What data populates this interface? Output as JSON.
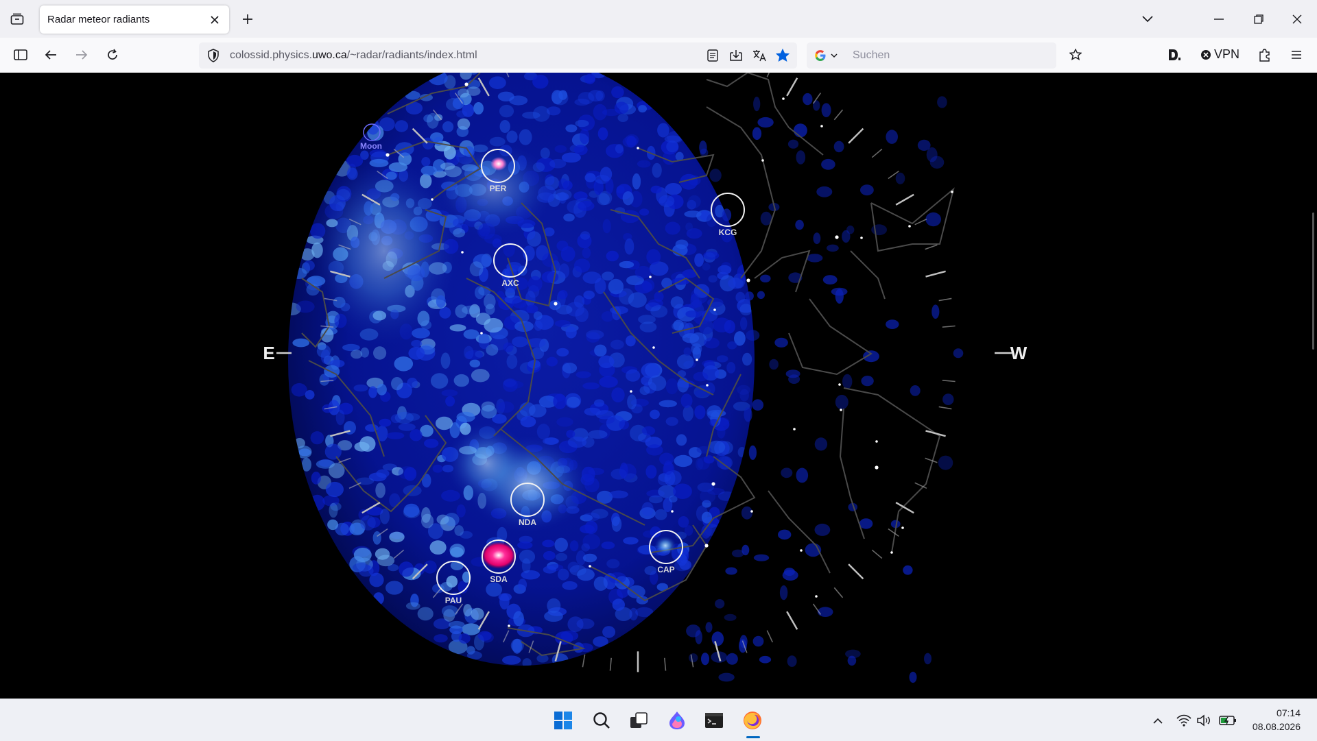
{
  "browser": {
    "tab_title": "Radar meteor radiants",
    "url_prefix": "colossid.physics.",
    "url_domain": "uwo.ca",
    "url_suffix": "/~radar/radiants/index.html",
    "search_placeholder": "Suchen",
    "vpn_label": "VPN",
    "accent": "#0060df"
  },
  "sky_map": {
    "directions": {
      "east": "E",
      "west": "W"
    },
    "moon_label": "Moon",
    "showers": [
      {
        "code": "PER"
      },
      {
        "code": "KCG"
      },
      {
        "code": "AXC"
      },
      {
        "code": "NDA"
      },
      {
        "code": "CAP"
      },
      {
        "code": "SDA"
      },
      {
        "code": "PAU"
      }
    ]
  },
  "taskbar": {
    "time": "07:14",
    "date": "08.08.2026"
  }
}
